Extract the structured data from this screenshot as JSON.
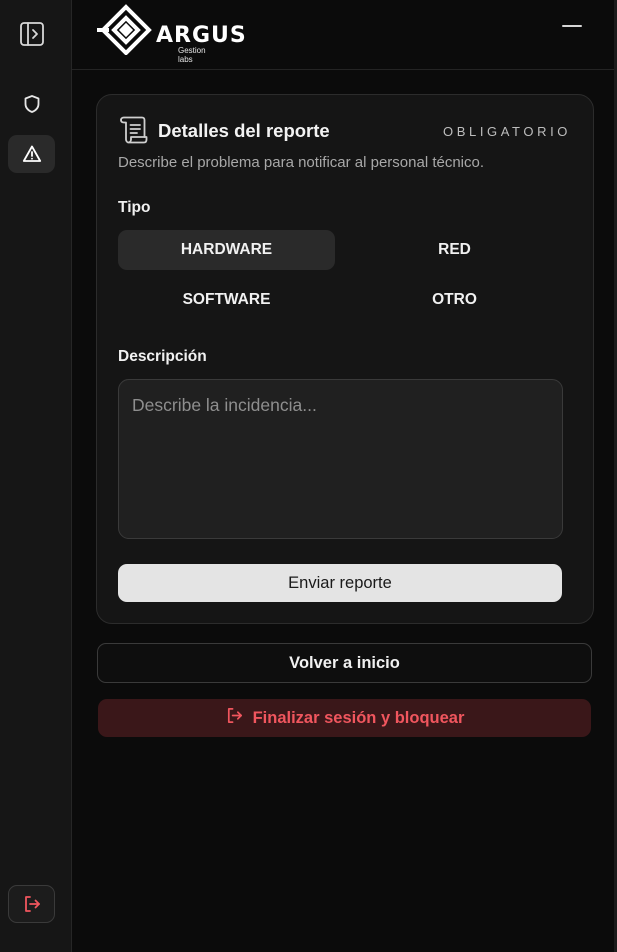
{
  "sidebar": {
    "items": [
      {
        "icon": "panel-toggle-icon"
      },
      {
        "icon": "shield-icon"
      },
      {
        "icon": "warning-icon",
        "active": true
      },
      {
        "icon": "logout-icon"
      }
    ]
  },
  "header": {
    "brand": "ARGUS",
    "brand_sub": "Gestion labs"
  },
  "report": {
    "title": "Detalles del reporte",
    "badge": "OBLIGATORIO",
    "subtitle": "Describe el problema para notificar al personal técnico.",
    "type_label": "Tipo",
    "types": [
      "HARDWARE",
      "RED",
      "SOFTWARE",
      "OTRO"
    ],
    "selected_type": "HARDWARE",
    "description_label": "Descripción",
    "description_placeholder": "Describe la incidencia...",
    "description_value": "",
    "send_label": "Enviar reporte"
  },
  "actions": {
    "back_label": "Volver a inicio",
    "finish_label": "Finalizar sesión y bloquear"
  },
  "colors": {
    "accent_red": "#f0565e",
    "danger_bg": "#3a1719",
    "primary_button": "#e4e4e4"
  }
}
